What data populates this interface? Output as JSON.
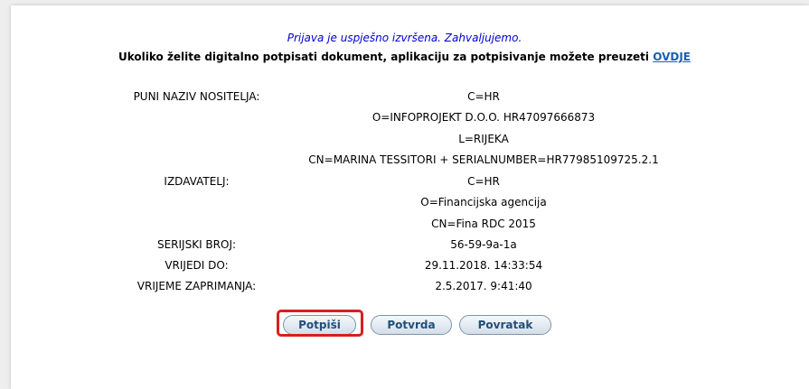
{
  "message": {
    "success": "Prijava je uspješno izvršena. Zahvaljujemo.",
    "download_text": "Ukoliko želite digitalno potpisati dokument, aplikaciju za potpisivanje možete preuzeti ",
    "download_link": "OVDJE"
  },
  "certificate": {
    "holder_label": "PUNI NAZIV NOSITELJA:",
    "holder_values": [
      "C=HR",
      "O=INFOPROJEKT D.O.O. HR47097666873",
      "L=RIJEKA",
      "CN=MARINA TESSITORI + SERIALNUMBER=HR77985109725.2.1"
    ],
    "issuer_label": "IZDAVATELJ:",
    "issuer_values": [
      "C=HR",
      "O=Financijska agencija",
      "CN=Fina RDC 2015"
    ],
    "serial_label": "SERIJSKI BROJ:",
    "serial_value": "56-59-9a-1a",
    "valid_label": "VRIJEDI DO:",
    "valid_value": "29.11.2018. 14:33:54",
    "received_label": "VRIJEME ZAPRIMANJA:",
    "received_value": "2.5.2017. 9:41:40"
  },
  "buttons": {
    "sign": "Potpiši",
    "confirm": "Potvrda",
    "back": "Povratak"
  },
  "colors": {
    "highlight": "#d91e1e",
    "link": "#1a5fb4",
    "success_text": "#0000cc"
  }
}
